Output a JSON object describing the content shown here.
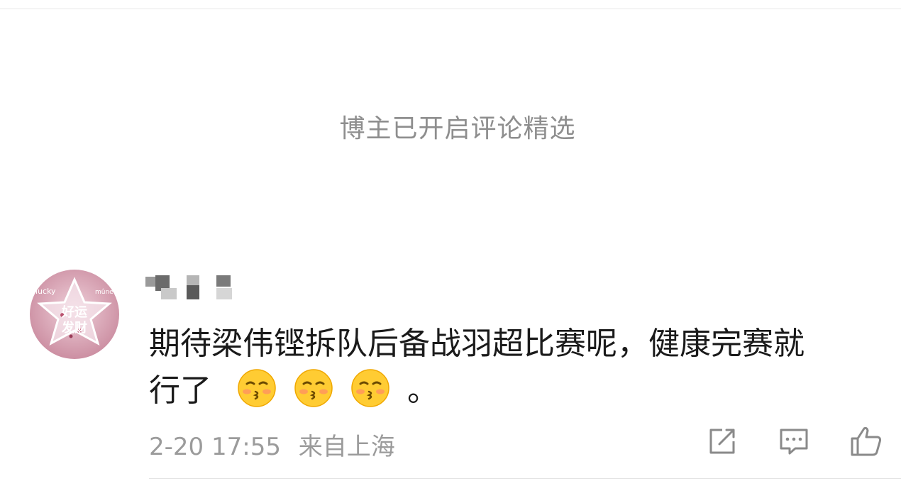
{
  "notice": {
    "text": "博主已开启评论精选"
  },
  "avatar": {
    "badge_top": "lucky",
    "badge_right": "mûne",
    "badge_text": "好运 发财"
  },
  "comment": {
    "text_line1": "期待梁伟铿拆队后备战羽超比赛呢，健康完赛就",
    "text_line2": "行了",
    "trailing_punct": "。",
    "emoji_names": [
      "kissing-emoji",
      "kissing-emoji",
      "kissing-emoji"
    ]
  },
  "meta": {
    "time": "2-20 17:55",
    "source": "来自上海"
  },
  "actions": [
    {
      "name": "share-icon"
    },
    {
      "name": "comment-icon"
    },
    {
      "name": "like-icon"
    }
  ],
  "colors": {
    "text_primary": "#1a1a1a",
    "text_secondary": "#8e8e8e",
    "avatar_bg": "#d8a3b3"
  }
}
